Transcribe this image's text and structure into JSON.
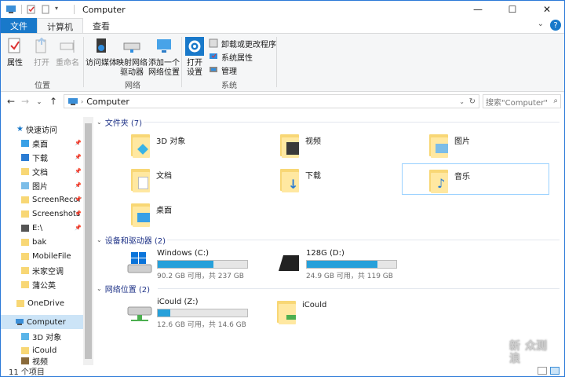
{
  "window": {
    "title": "Computer"
  },
  "tabs": {
    "file": "文件",
    "computer": "计算机",
    "view": "查看"
  },
  "ribbon": {
    "location_group": {
      "label": "位置",
      "properties": "属性",
      "open": "打开",
      "rename": "重命名"
    },
    "network_group": {
      "label": "网络",
      "access_media": "访问媒体",
      "map_drive": "映射网络\n驱动器",
      "add_location": "添加一个\n网络位置"
    },
    "system_group": {
      "label": "系统",
      "open_settings": "打开\n设置",
      "uninstall": "卸载或更改程序",
      "system_properties": "系统属性",
      "manage": "管理"
    }
  },
  "address": {
    "path": "Computer",
    "search_placeholder": "搜索\"Computer\""
  },
  "nav": {
    "quick_access": "快速访问",
    "items": [
      {
        "label": "桌面",
        "pinned": true
      },
      {
        "label": "下载",
        "pinned": true
      },
      {
        "label": "文档",
        "pinned": true
      },
      {
        "label": "图片",
        "pinned": true
      },
      {
        "label": "ScreenRecor",
        "pinned": true
      },
      {
        "label": "Screenshots",
        "pinned": true
      },
      {
        "label": "E:\\",
        "pinned": true
      },
      {
        "label": "bak",
        "pinned": false
      },
      {
        "label": "MobileFile",
        "pinned": false
      },
      {
        "label": "米家空调",
        "pinned": false
      },
      {
        "label": "蒲公英",
        "pinned": false
      }
    ],
    "onedrive": "OneDrive",
    "computer": "Computer",
    "sub_items": [
      {
        "label": "3D 对象"
      },
      {
        "label": "iCould"
      },
      {
        "label": "视频"
      }
    ]
  },
  "content": {
    "folders_header": "文件夹 (7)",
    "folders": [
      {
        "label": "3D 对象",
        "icon": "3d-objects-folder-icon"
      },
      {
        "label": "视频",
        "icon": "videos-folder-icon"
      },
      {
        "label": "图片",
        "icon": "pictures-folder-icon"
      },
      {
        "label": "文档",
        "icon": "documents-folder-icon"
      },
      {
        "label": "下载",
        "icon": "downloads-folder-icon"
      },
      {
        "label": "音乐",
        "icon": "music-folder-icon"
      },
      {
        "label": "桌面",
        "icon": "desktop-folder-icon"
      }
    ],
    "drives_header": "设备和驱动器 (2)",
    "drives": [
      {
        "name": "Windows (C:)",
        "free": "90.2 GB 可用，共 237 GB",
        "used_fraction": 0.62
      },
      {
        "name": "128G (D:)",
        "free": "24.9 GB 可用，共 119 GB",
        "used_fraction": 0.79
      }
    ],
    "network_header": "网络位置 (2)",
    "network": [
      {
        "name": "iCould (Z:)",
        "free": "12.6 GB 可用，共 14.6 GB",
        "used_fraction": 0.14
      },
      {
        "name": "iCould"
      }
    ]
  },
  "status": {
    "count": "11 个项目"
  },
  "watermark": {
    "line1": "新",
    "line2": "浪",
    "line3": "众测"
  },
  "colors": {
    "accent": "#1979ca",
    "drive_fill": "#26a0da",
    "selection": "#cce4f7",
    "folder": "#f8d775"
  }
}
